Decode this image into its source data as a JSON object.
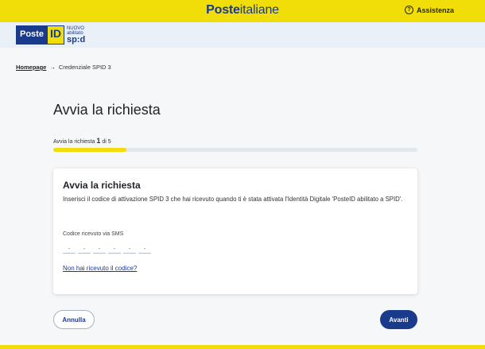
{
  "header": {
    "brand_bold": "Poste",
    "brand_regular": "italiane",
    "assist_label": "Assistenza",
    "assist_icon": "question-circle-icon",
    "assist_icon_glyph": "?"
  },
  "logo": {
    "poste": "Poste",
    "id": "ID",
    "nuovo": "NUOVO",
    "abilitato": "abilitato",
    "spid": "sp:d"
  },
  "breadcrumb": {
    "home": "Homepage",
    "separator": "→",
    "current": "Credenziale SPID 3"
  },
  "page": {
    "title": "Avvia la richiesta"
  },
  "progress": {
    "label": "Avvia la richiesta",
    "current": "1",
    "of_text": "di 5",
    "fraction": 0.2
  },
  "card": {
    "title": "Avvia la richiesta",
    "description": "Inserisci il codice di attivazione SPID 3 che hai ricevuto quando ti è stata attivata l'Identità Digitale 'PosteID abilitato a SPID'.",
    "sms_label": "Codice ricevuto via SMS",
    "digit_placeholder": "-",
    "resend_link": "Non hai ricevuto il codice?"
  },
  "actions": {
    "cancel": "Annulla",
    "next": "Avanti"
  },
  "colors": {
    "brand_yellow": "#f1de08",
    "brand_blue": "#1a3a8c",
    "background": "#f6f7f8"
  }
}
